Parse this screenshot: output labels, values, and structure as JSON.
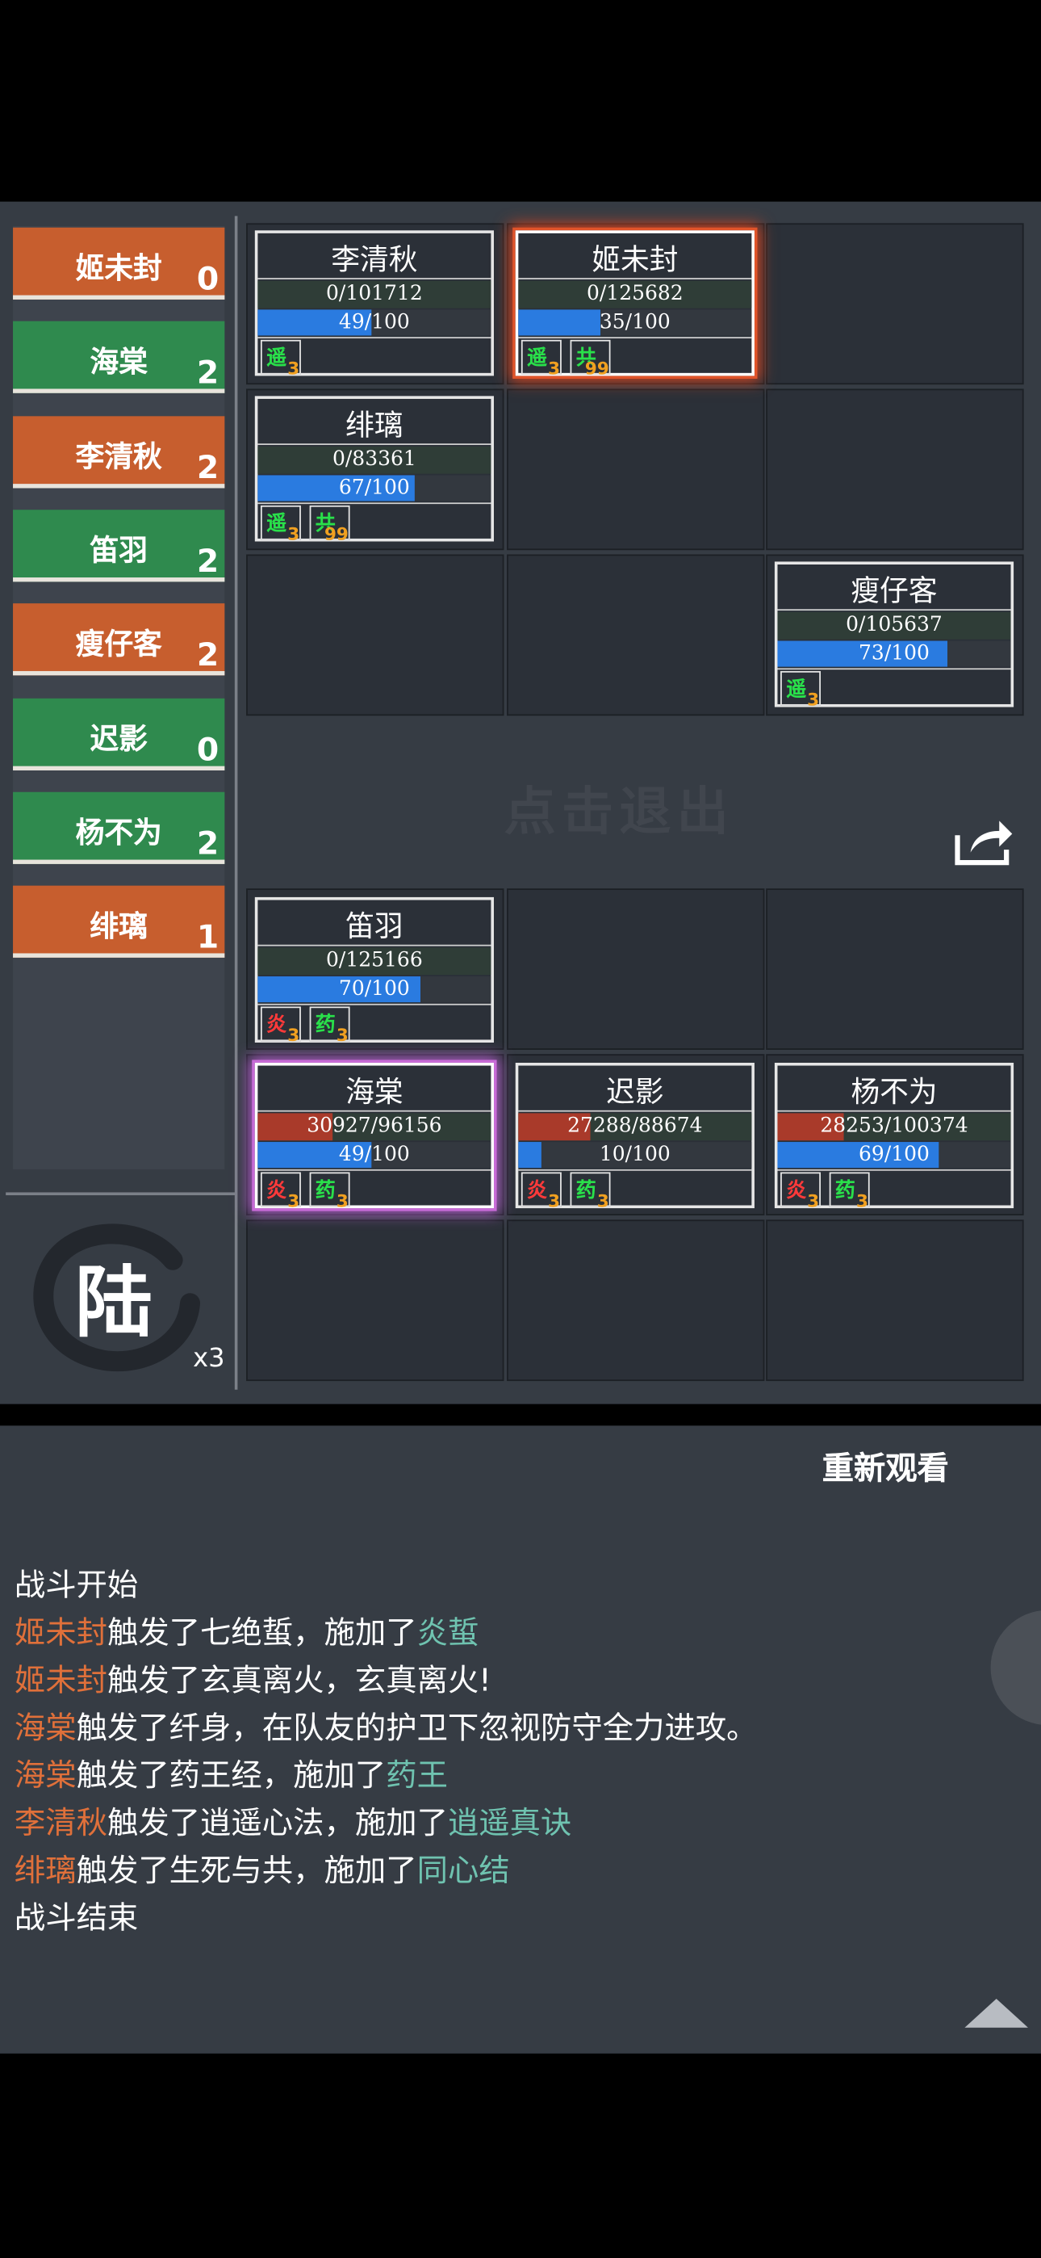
{
  "sidebar": {
    "items": [
      {
        "label": "姬未封",
        "count": "0",
        "color": "orange"
      },
      {
        "label": "海棠",
        "count": "2",
        "color": "green"
      },
      {
        "label": "李清秋",
        "count": "2",
        "color": "orange"
      },
      {
        "label": "笛羽",
        "count": "2",
        "color": "green"
      },
      {
        "label": "瘦仔客",
        "count": "2",
        "color": "orange"
      },
      {
        "label": "迟影",
        "count": "0",
        "color": "green"
      },
      {
        "label": "杨不为",
        "count": "2",
        "color": "green"
      },
      {
        "label": "绯璃",
        "count": "1",
        "color": "orange"
      }
    ],
    "round_char": "陆",
    "speed": "x3"
  },
  "enemy": {
    "cards": [
      {
        "name": "李清秋",
        "hp": "0/101712",
        "hp_fraction": 0,
        "mp": "49/100",
        "mp_fraction": 0.49,
        "buffs": [
          {
            "char": "遥",
            "n": "3",
            "color": "green"
          }
        ]
      },
      {
        "name": "姬未封",
        "hp": "0/125682",
        "hp_fraction": 0,
        "mp": "35/100",
        "mp_fraction": 0.35,
        "buffs": [
          {
            "char": "遥",
            "n": "3",
            "color": "green"
          },
          {
            "char": "共",
            "n": "99",
            "color": "green"
          }
        ]
      },
      {
        "name": "绯璃",
        "hp": "0/83361",
        "hp_fraction": 0,
        "mp": "67/100",
        "mp_fraction": 0.67,
        "buffs": [
          {
            "char": "遥",
            "n": "3",
            "color": "green"
          },
          {
            "char": "共",
            "n": "99",
            "color": "green"
          }
        ]
      },
      {
        "name": "瘦仔客",
        "hp": "0/105637",
        "hp_fraction": 0,
        "mp": "73/100",
        "mp_fraction": 0.73,
        "buffs": [
          {
            "char": "遥",
            "n": "3",
            "color": "green"
          }
        ]
      }
    ]
  },
  "exit_hint": "点击退出",
  "ally": {
    "cards": [
      {
        "name": "笛羽",
        "hp": "0/125166",
        "hp_fraction": 0,
        "mp": "70/100",
        "mp_fraction": 0.7,
        "buffs": [
          {
            "char": "炎",
            "n": "3",
            "color": "red"
          },
          {
            "char": "药",
            "n": "3",
            "color": "green"
          }
        ]
      },
      {
        "name": "海棠",
        "hp": "30927/96156",
        "hp_fraction": 0.3216,
        "mp": "49/100",
        "mp_fraction": 0.49,
        "buffs": [
          {
            "char": "炎",
            "n": "3",
            "color": "red"
          },
          {
            "char": "药",
            "n": "3",
            "color": "green"
          }
        ]
      },
      {
        "name": "迟影",
        "hp": "27288/88674",
        "hp_fraction": 0.3077,
        "mp": "10/100",
        "mp_fraction": 0.1,
        "buffs": [
          {
            "char": "炎",
            "n": "3",
            "color": "red"
          },
          {
            "char": "药",
            "n": "3",
            "color": "green"
          }
        ]
      },
      {
        "name": "杨不为",
        "hp": "28253/100374",
        "hp_fraction": 0.2815,
        "mp": "69/100",
        "mp_fraction": 0.69,
        "buffs": [
          {
            "char": "炎",
            "n": "3",
            "color": "red"
          },
          {
            "char": "药",
            "n": "3",
            "color": "green"
          }
        ]
      }
    ]
  },
  "replay_label": "重新观看",
  "log": {
    "start": "战斗开始",
    "lines": [
      {
        "actor": "姬未封",
        "text": "触发了七绝蜇，施加了",
        "effect": "炎蜇"
      },
      {
        "actor": "姬未封",
        "text": "触发了玄真离火，玄真离火!",
        "effect": ""
      },
      {
        "actor": "海棠",
        "text": "触发了纤身，在队友的护卫下忽视防守全力进攻。",
        "effect": ""
      },
      {
        "actor": "海棠",
        "text": "触发了药王经，施加了",
        "effect": "药王"
      },
      {
        "actor": "李清秋",
        "text": "触发了逍遥心法，施加了",
        "effect": "逍遥真诀"
      },
      {
        "actor": "绯璃",
        "text": "触发了生死与共，施加了",
        "effect": "同心结"
      }
    ],
    "end": "战斗结束"
  },
  "colors": {
    "orange": "#c75e2e",
    "green": "#2f8a4e",
    "actor": "#e0703a",
    "effect": "#6fc3b0"
  }
}
